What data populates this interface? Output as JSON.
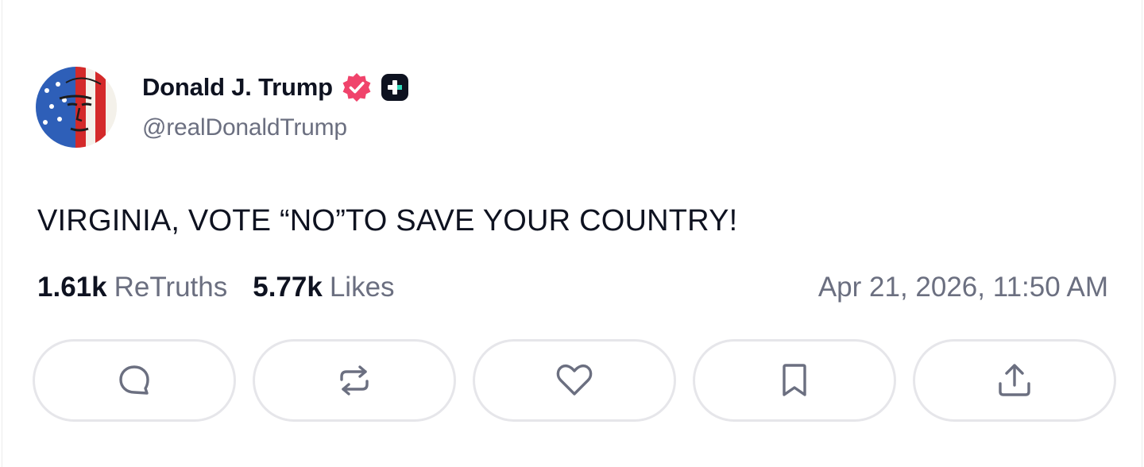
{
  "author": {
    "display_name": "Donald J. Trump",
    "handle": "@realDonaldTrump",
    "avatar_icon": "flag-face-avatar",
    "verified_icon": "verified-badge-icon",
    "plus_badge_icon": "plus-badge-icon",
    "verified_color": "#f0436b"
  },
  "post": {
    "text": "VIRGINIA, VOTE “NO”TO SAVE YOUR COUNTRY!"
  },
  "stats": {
    "retruths_count": "1.61k",
    "retruths_label": "ReTruths",
    "likes_count": "5.77k",
    "likes_label": "Likes",
    "timestamp": "Apr 21, 2026, 11:50 AM"
  },
  "actions": [
    {
      "icon": "reply-icon"
    },
    {
      "icon": "retruth-icon"
    },
    {
      "icon": "like-icon"
    },
    {
      "icon": "bookmark-icon"
    },
    {
      "icon": "share-icon"
    }
  ],
  "colors": {
    "text": "#0e1220",
    "muted": "#6b6f80",
    "border": "#e6e6ea"
  }
}
